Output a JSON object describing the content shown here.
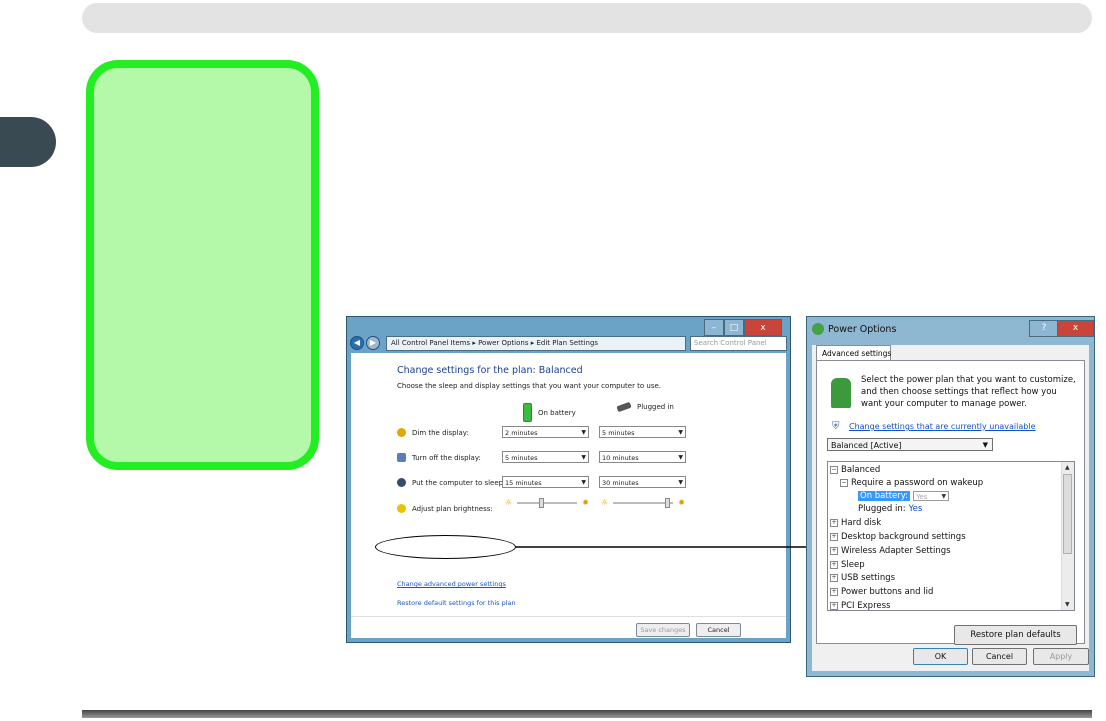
{
  "left_window": {
    "address_path": "All Control Panel Items  ▸  Power Options  ▸  Edit Plan Settings",
    "search_placeholder": "Search Control Panel",
    "title": "Change settings for the plan: Balanced",
    "subtitle": "Choose the sleep and display settings that you want your computer to use.",
    "col_battery": "On battery",
    "col_plugged": "Plugged in",
    "rows": [
      {
        "label": "Dim the display:",
        "battery": "2 minutes",
        "plugged": "5 minutes"
      },
      {
        "label": "Turn off the display:",
        "battery": "5 minutes",
        "plugged": "10 minutes"
      },
      {
        "label": "Put the computer to sleep:",
        "battery": "15 minutes",
        "plugged": "30 minutes"
      }
    ],
    "brightness_label": "Adjust plan brightness:",
    "brightness_battery_level": 0.4,
    "brightness_plugged_level": 0.9,
    "link_advanced": "Change advanced power settings",
    "link_restore": "Restore default settings for this plan",
    "save_button": "Save changes",
    "cancel_button": "Cancel"
  },
  "right_dialog": {
    "title": "Power Options",
    "tab": "Advanced settings",
    "description": "Select the power plan that you want to customize, and then choose settings that reflect how you want your computer to manage power.",
    "link_unavailable": "Change settings that are currently unavailable",
    "plan_select": "Balanced [Active]",
    "tree": {
      "balanced": "Balanced",
      "require_password": "Require a password on wakeup",
      "on_battery": "On battery:",
      "on_battery_value": "Yes",
      "plugged_in": "Plugged in:",
      "plugged_in_value": "Yes",
      "hard_disk": "Hard disk",
      "desktop_bg": "Desktop background settings",
      "wireless": "Wireless Adapter Settings",
      "sleep": "Sleep",
      "usb": "USB settings",
      "power_buttons": "Power buttons and lid",
      "pci_express": "PCI Express"
    },
    "restore_button": "Restore plan defaults",
    "ok_button": "OK",
    "cancel_button": "Cancel",
    "apply_button": "Apply"
  }
}
